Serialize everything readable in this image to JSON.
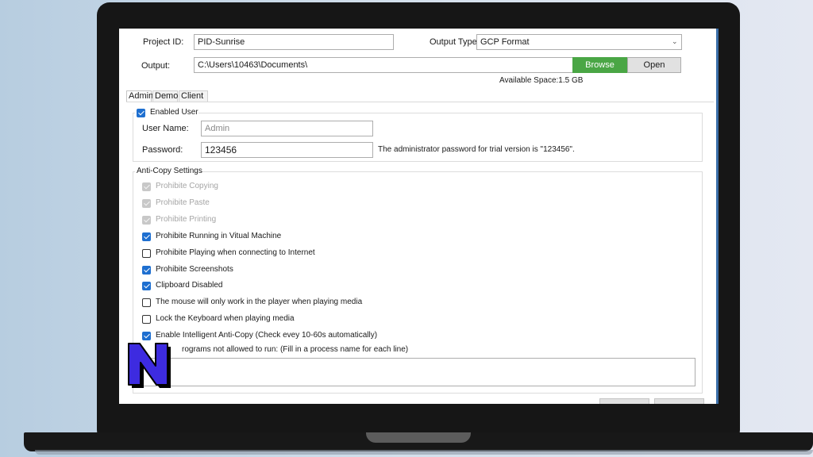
{
  "form": {
    "project_id_label": "Project ID:",
    "project_id_value": "PID-Sunrise",
    "output_type_label": "Output Type:",
    "output_type_value": "GCP Format",
    "output_label": "Output:",
    "output_value": "C:\\Users\\10463\\Documents\\",
    "browse_label": "Browse",
    "open_label": "Open",
    "available_space": "Available Space:1.5 GB"
  },
  "tabs": [
    {
      "label": "Admin",
      "active": true
    },
    {
      "label": "Demo",
      "active": false
    },
    {
      "label": "Client",
      "active": false
    }
  ],
  "admin": {
    "enabled_user_label": "Enabled User",
    "enabled_user_checked": true,
    "user_name_label": "User Name:",
    "user_name_placeholder": "Admin",
    "password_label": "Password:",
    "password_value": "123456",
    "password_note": "The administrator password for trial version is \"123456\"."
  },
  "anti_copy": {
    "title": "Anti-Copy Settings",
    "options": [
      {
        "label": "Prohibite Copying",
        "state": "disabled"
      },
      {
        "label": "Prohibite Paste",
        "state": "disabled"
      },
      {
        "label": "Prohibite Printing",
        "state": "disabled"
      },
      {
        "label": "Prohibite Running in Vitual Machine",
        "state": "checked"
      },
      {
        "label": "Prohibite Playing when connecting to Internet",
        "state": "unchecked"
      },
      {
        "label": "Prohibite Screenshots",
        "state": "checked"
      },
      {
        "label": "Clipboard Disabled",
        "state": "checked"
      },
      {
        "label": "The mouse will only work in the player when playing media",
        "state": "unchecked"
      },
      {
        "label": "Lock the Keyboard when playing media",
        "state": "unchecked"
      },
      {
        "label": "Enable Intelligent Anti-Copy (Check evey 10-60s automatically)",
        "state": "checked"
      }
    ],
    "programs_label": "rograms not allowed to run: (Fill in a process name for each line)"
  },
  "colors": {
    "accent_blue": "#1e6fd0",
    "browse_green": "#4aa645",
    "logo_blue": "#3d2be0"
  },
  "logo_icon": "n-logo-icon"
}
